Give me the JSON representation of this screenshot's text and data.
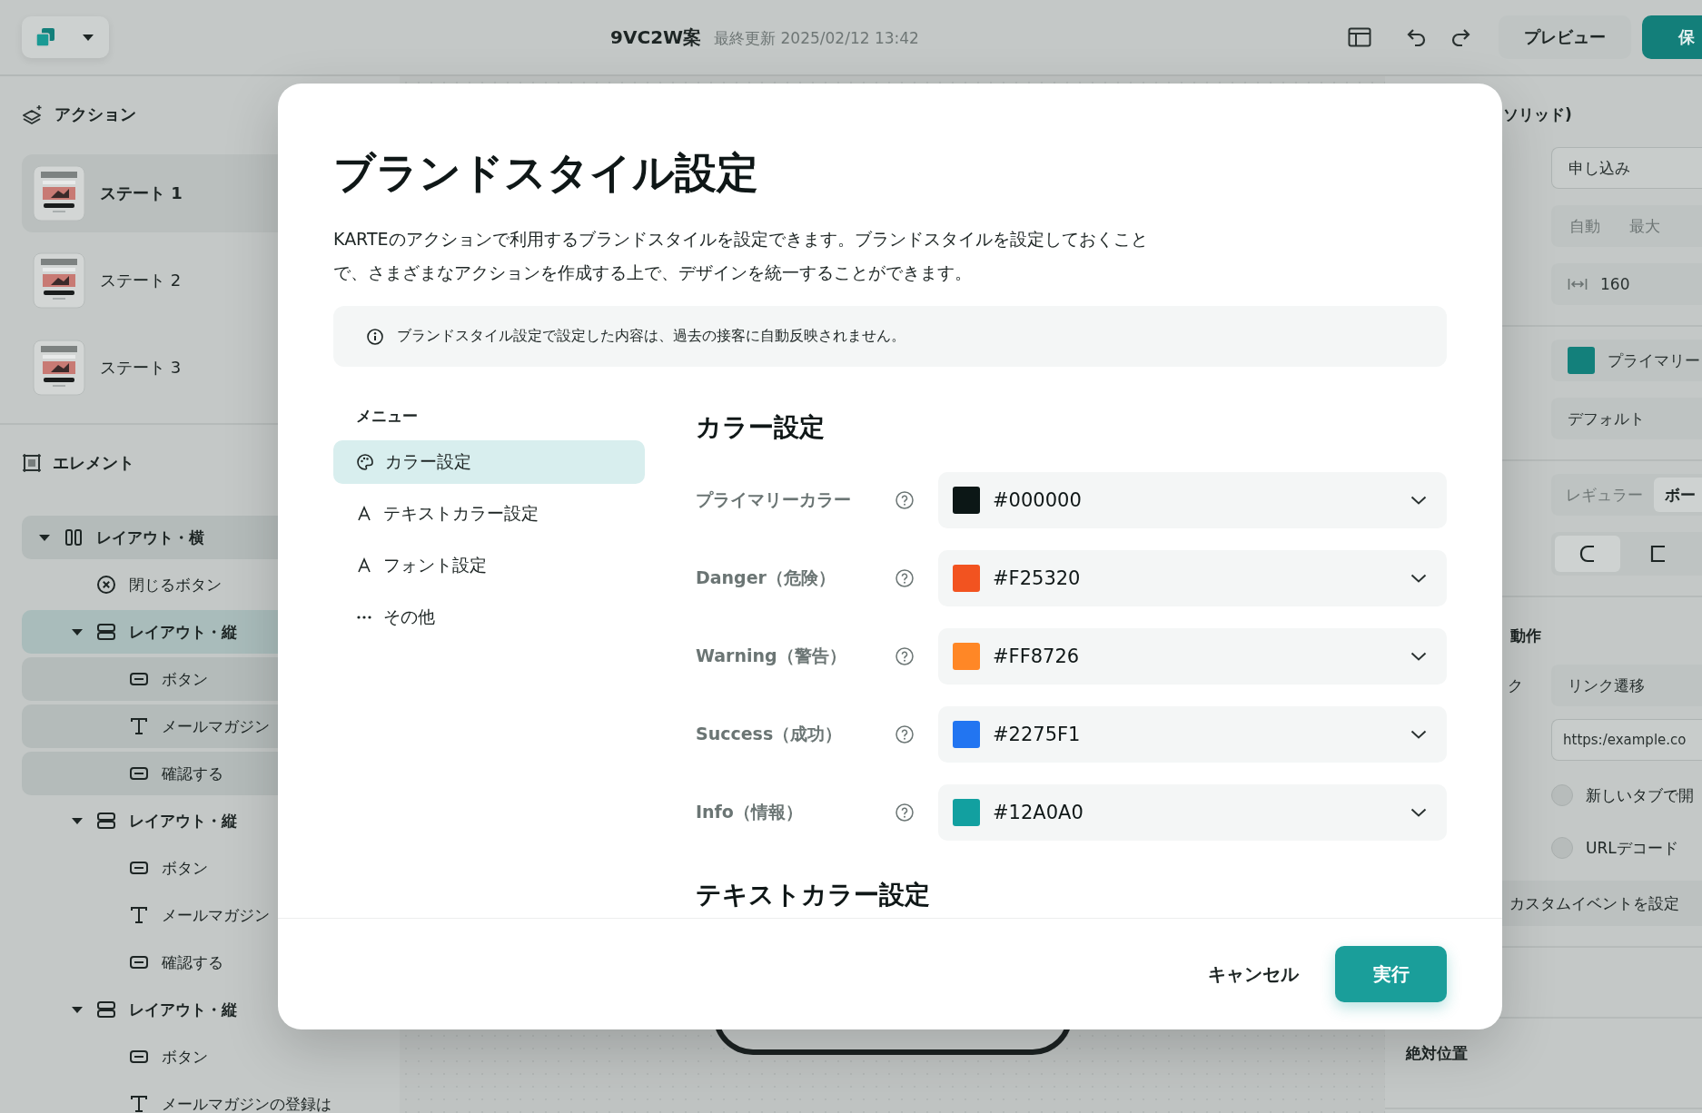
{
  "topbar": {
    "title": "9VC2W案",
    "updated": "最終更新 2025/02/12 13:42",
    "preview_button": "プレビュー",
    "save_button": "保"
  },
  "sidebar": {
    "actions_title": "アクション",
    "states": [
      {
        "label": "ステート 1",
        "selected": true
      },
      {
        "label": "ステート 2",
        "selected": false
      },
      {
        "label": "ステート 3",
        "selected": false
      }
    ],
    "elements_title": "エレメント",
    "tree": [
      {
        "label": "レイアウト・横",
        "kind": "row-layout",
        "expanded": true,
        "selected": false,
        "highlighted": true,
        "children": [
          {
            "label": "閉じるボタン",
            "kind": "close-button",
            "selected": false,
            "highlighted": false
          },
          {
            "label": "レイアウト・縦",
            "kind": "column-layout",
            "expanded": true,
            "selected": true,
            "highlighted": false,
            "children": [
              {
                "label": "ボタン",
                "kind": "button",
                "selected": false,
                "highlighted": true
              },
              {
                "label": "メールマガジン",
                "kind": "text",
                "selected": false,
                "highlighted": true
              },
              {
                "label": "確認する",
                "kind": "button",
                "selected": false,
                "highlighted": true
              }
            ]
          },
          {
            "label": "レイアウト・縦",
            "kind": "column-layout",
            "expanded": true,
            "selected": false,
            "highlighted": false,
            "children": [
              {
                "label": "ボタン",
                "kind": "button",
                "selected": false,
                "highlighted": false
              },
              {
                "label": "メールマガジン",
                "kind": "text",
                "selected": false,
                "highlighted": false
              },
              {
                "label": "確認する",
                "kind": "button",
                "selected": false,
                "highlighted": false
              }
            ]
          },
          {
            "label": "レイアウト・縦",
            "kind": "column-layout",
            "expanded": true,
            "selected": false,
            "highlighted": false,
            "children": [
              {
                "label": "ボタン",
                "kind": "button",
                "selected": false,
                "highlighted": false
              },
              {
                "label": "メールマガジンの登録は",
                "kind": "text",
                "selected": false,
                "highlighted": false
              }
            ]
          }
        ]
      }
    ]
  },
  "right_panel": {
    "section_title": "ソリッド)",
    "label_field": "申し込み",
    "width_modes": [
      {
        "label": "自動",
        "selected": false
      },
      {
        "label": "最大",
        "selected": false
      }
    ],
    "width_value": "160",
    "color_select": {
      "label": "プライマリー",
      "color": "#13807b"
    },
    "variant_select": "デフォルト",
    "weights": [
      {
        "label": "レギュラー",
        "selected": false
      },
      {
        "label": "ボー",
        "selected": true
      }
    ],
    "corners": [
      {
        "kind": "rounded",
        "selected": true
      },
      {
        "kind": "square",
        "selected": false
      }
    ],
    "behavior_title": "動作",
    "link_label": "ク",
    "link_select": "リンク遷移",
    "url_field": "https:/example.co",
    "checkboxes": [
      {
        "label": "新しいタブで開",
        "checked": false
      },
      {
        "label": "URLデコード",
        "checked": false
      }
    ],
    "custom_event_button": "カスタムイベントを設定",
    "position_title": "絶対位置"
  },
  "dialog": {
    "title": "ブランドスタイル設定",
    "description": "KARTEのアクションで利用するブランドスタイルを設定できます。ブランドスタイルを設定しておくことで、さまざまなアクションを作成する上で、デザインを統一することができます。",
    "notice": "ブランドスタイル設定で設定した内容は、過去の接客に自動反映されません。",
    "menu_title": "メニュー",
    "menu": [
      {
        "label": "カラー設定",
        "kind": "palette",
        "selected": true
      },
      {
        "label": "テキストカラー設定",
        "kind": "letter",
        "selected": false
      },
      {
        "label": "フォント設定",
        "kind": "letter",
        "selected": false
      },
      {
        "label": "その他",
        "kind": "more",
        "selected": false
      }
    ],
    "section_title": "カラー設定",
    "colors": [
      {
        "label": "プライマリーカラー",
        "value": "#000000",
        "color": "#0c1716"
      },
      {
        "label": "Danger（危険）",
        "value": "#F25320",
        "color": "#f25320"
      },
      {
        "label": "Warning（警告）",
        "value": "#FF8726",
        "color": "#ff8726"
      },
      {
        "label": "Success（成功）",
        "value": "#2275F1",
        "color": "#2275f1"
      },
      {
        "label": "Info（情報）",
        "value": "#12A0A0",
        "color": "#12a0a0"
      }
    ],
    "next_section_title": "テキストカラー設定",
    "cancel_button": "キャンセル",
    "submit_button": "実行"
  }
}
